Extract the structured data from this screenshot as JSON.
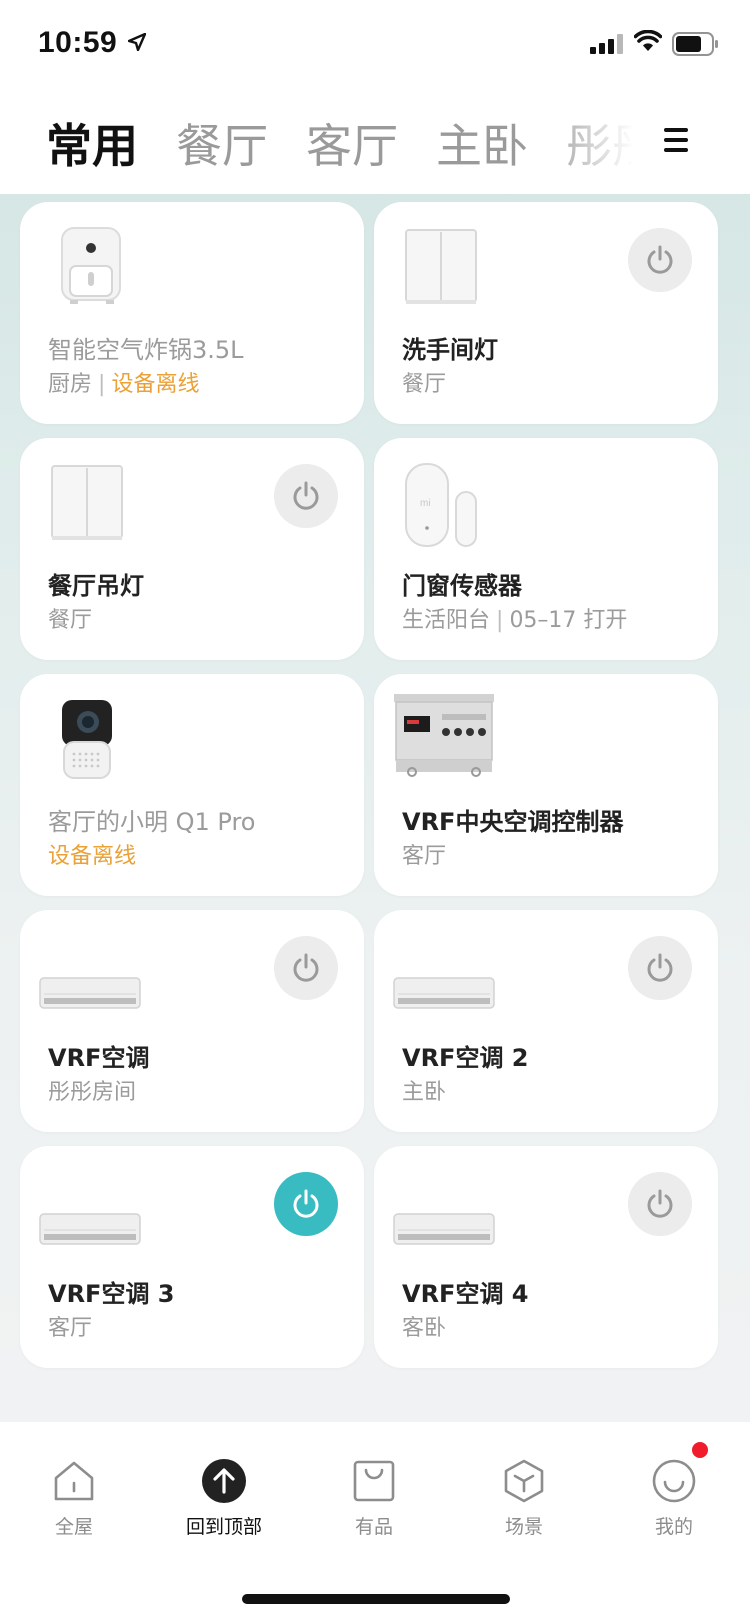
{
  "status": {
    "time": "10:59"
  },
  "tabs": [
    {
      "label": "常用",
      "active": true
    },
    {
      "label": "餐厅"
    },
    {
      "label": "客厅"
    },
    {
      "label": "主卧"
    },
    {
      "label": "彤彤"
    }
  ],
  "devices": [
    {
      "title": "智能空气炸锅3.5L",
      "room": "厨房",
      "status": "设备离线",
      "offline": true
    },
    {
      "title": "洗手间灯",
      "room": "餐厅",
      "power": "off"
    },
    {
      "title": "餐厅吊灯",
      "room": "餐厅",
      "power": "off"
    },
    {
      "title": "门窗传感器",
      "room": "生活阳台",
      "status": "05–17 打开"
    },
    {
      "title": "客厅的小明 Q1 Pro",
      "status": "设备离线",
      "offline": true
    },
    {
      "title": "VRF中央空调控制器",
      "room": "客厅"
    },
    {
      "title": "VRF空调",
      "room": "彤彤房间",
      "power": "off"
    },
    {
      "title": "VRF空调 2",
      "room": "主卧",
      "power": "off"
    },
    {
      "title": "VRF空调 3",
      "room": "客厅",
      "power": "on"
    },
    {
      "title": "VRF空调 4",
      "room": "客卧",
      "power": "off"
    }
  ],
  "bottom_nav": [
    {
      "label": "全屋",
      "icon": "home-icon"
    },
    {
      "label": "回到顶部",
      "icon": "arrow-up-icon",
      "active": true
    },
    {
      "label": "有品",
      "icon": "shop-bag-icon"
    },
    {
      "label": "场景",
      "icon": "scene-cube-icon"
    },
    {
      "label": "我的",
      "icon": "smile-profile-icon"
    }
  ],
  "colors": {
    "accent": "#38bcc1",
    "warning": "#eba135",
    "badge": "#f01c2b"
  }
}
